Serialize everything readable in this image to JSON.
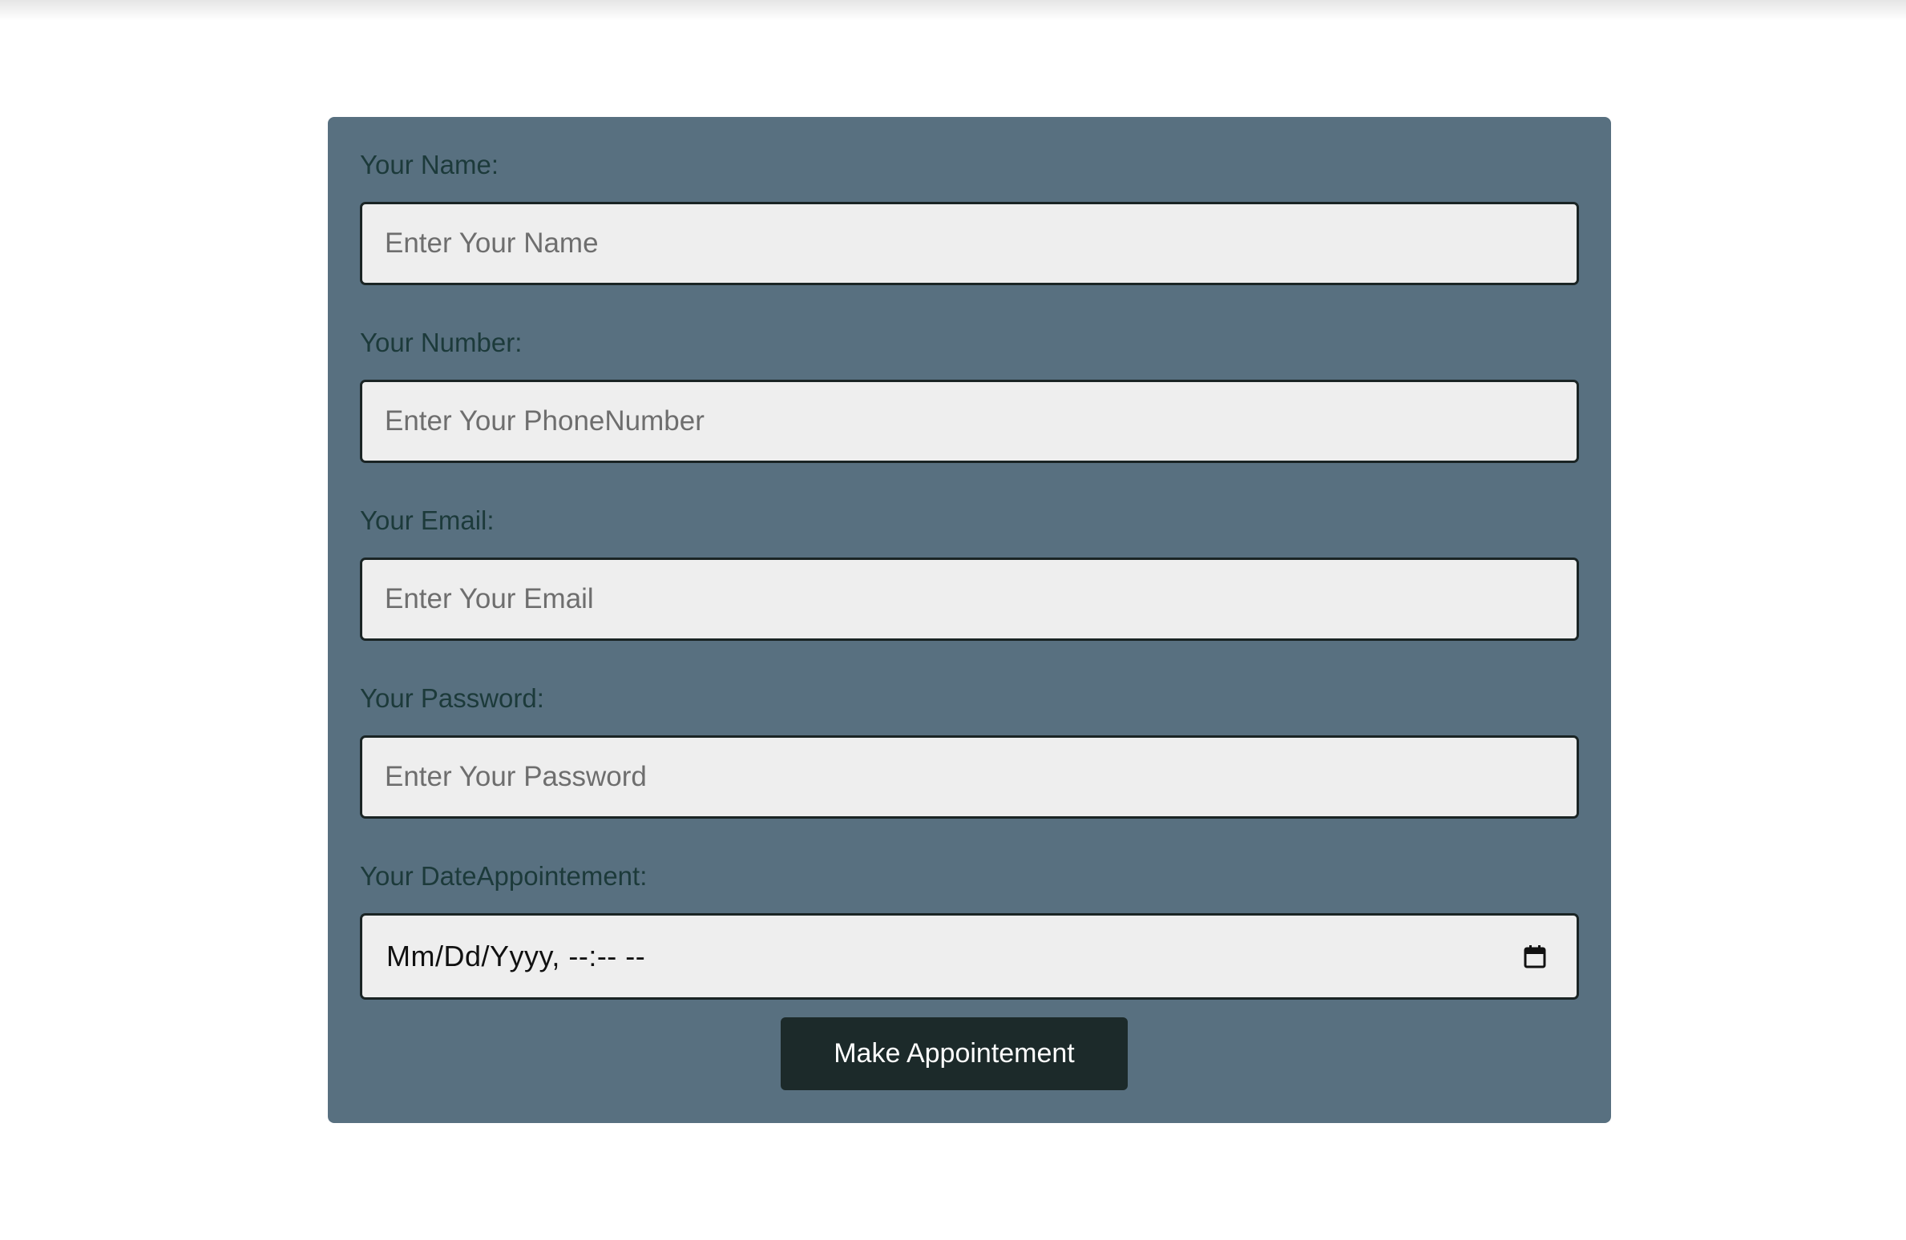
{
  "form": {
    "name": {
      "label": "Your Name:",
      "placeholder": "Enter Your Name",
      "value": ""
    },
    "number": {
      "label": "Your Number:",
      "placeholder": "Enter Your PhoneNumber",
      "value": ""
    },
    "email": {
      "label": "Your Email:",
      "placeholder": "Enter Your Email",
      "value": ""
    },
    "password": {
      "label": "Your Password:",
      "placeholder": "Enter Your Password",
      "value": ""
    },
    "date": {
      "label": "Your DateAppointement:",
      "display_value": "Mm/Dd/Yyyy, --:-- --",
      "icon": "calendar-icon"
    },
    "submit_label": "Make Appointement"
  },
  "colors": {
    "panel": "#587080",
    "label": "#1c3a3a",
    "input_bg": "#eeeeee",
    "input_border": "#1a2424",
    "button_bg": "#1c2a2a",
    "button_text": "#ffffff"
  }
}
